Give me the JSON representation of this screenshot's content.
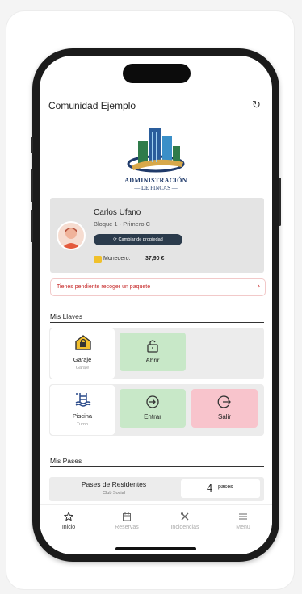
{
  "header": {
    "title": "Comunidad Ejemplo",
    "refresh_icon": "refresh-icon"
  },
  "logo": {
    "line1": "ADMINISTRACIÓN",
    "line2": "— DE FINCAS —"
  },
  "profile": {
    "name": "Carlos Ufano",
    "unit": "Bloque 1 - Primero C",
    "change_button": "Cambiar de propiedad",
    "wallet_label": "Monedero:",
    "wallet_amount": "37,90 €"
  },
  "alert": {
    "text": "Tienes pendiente recoger un paquete"
  },
  "keys": {
    "title": "Mis Llaves",
    "items": [
      {
        "name": "Garaje",
        "sub": "Garaje",
        "icon": "garage-lock-icon",
        "actions": [
          {
            "label": "Abrir",
            "icon": "unlock-icon"
          }
        ]
      },
      {
        "name": "Piscina",
        "sub": "Turno",
        "icon": "pool-icon",
        "actions": [
          {
            "label": "Entrar",
            "icon": "enter-icon"
          },
          {
            "label": "Salir",
            "icon": "exit-icon"
          }
        ]
      }
    ]
  },
  "passes": {
    "title": "Mis Pases",
    "items": [
      {
        "name": "Pases de Residentes",
        "sub": "Club Social",
        "count": "4",
        "unit": "pases"
      }
    ]
  },
  "tabs": [
    {
      "label": "Inicio",
      "icon": "star-icon",
      "active": true
    },
    {
      "label": "Reservas",
      "icon": "calendar-icon",
      "active": false
    },
    {
      "label": "Incidencias",
      "icon": "tools-icon",
      "active": false
    },
    {
      "label": "Menu",
      "icon": "menu-icon",
      "active": false
    }
  ],
  "colors": {
    "green": "#c8e8c8",
    "red": "#f8c4cc",
    "dark_button": "#2b3b4c",
    "alert": "#c62828"
  }
}
